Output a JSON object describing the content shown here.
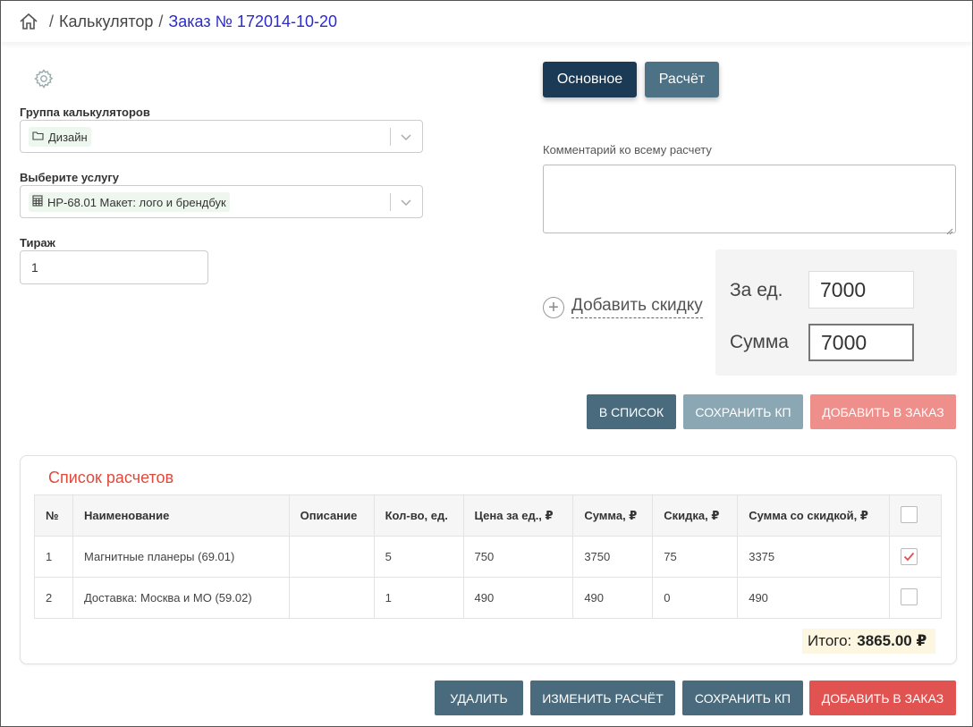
{
  "breadcrumb": {
    "home_icon": "home-icon",
    "sep1": "/",
    "calculator": "Калькулятор",
    "sep2": "/",
    "order": "Заказ № 172014-10-20"
  },
  "form": {
    "group_label": "Группа калькуляторов",
    "group_value": "Дизайн",
    "service_label": "Выберите услугу",
    "service_value": "НР-68.01 Макет: лого и брендбук",
    "qty_label": "Тираж",
    "qty_value": "1"
  },
  "tabs": {
    "main": "Основное",
    "calc": "Расчёт"
  },
  "comment": {
    "label": "Комментарий ко всему расчету",
    "value": ""
  },
  "discount": {
    "label": "Добавить скидку"
  },
  "price": {
    "unit_label": "За ед.",
    "unit_value": "7000",
    "sum_label": "Сумма",
    "sum_value": "7000"
  },
  "actions_top": {
    "to_list": "В СПИСОК",
    "save_kp": "СОХРАНИТЬ КП",
    "add_order": "ДОБАВИТЬ В ЗАКАЗ"
  },
  "list": {
    "title": "Список расчетов",
    "columns": [
      "№",
      "Наименование",
      "Описание",
      "Кол-во, ед.",
      "Цена за ед., ₽",
      "Сумма, ₽",
      "Скидка, ₽",
      "Сумма со скидкой, ₽"
    ],
    "rows": [
      {
        "n": "1",
        "name": "Магнитные планеры (69.01)",
        "desc": "",
        "qty": "5",
        "price": "750",
        "sum": "3750",
        "discount": "75",
        "total": "3375",
        "checked": true
      },
      {
        "n": "2",
        "name": "Доставка: Москва и МО (59.02)",
        "desc": "",
        "qty": "1",
        "price": "490",
        "sum": "490",
        "discount": "0",
        "total": "490",
        "checked": false
      }
    ],
    "total_label": "Итого:",
    "total_value": "3865.00 ₽"
  },
  "actions_bottom": {
    "delete": "УДАЛИТЬ",
    "edit": "ИЗМЕНИТЬ РАСЧЁТ",
    "save_kp": "СОХРАНИТЬ КП",
    "add_order": "ДОБАВИТЬ В ЗАКАЗ"
  },
  "colors": {
    "tab_main": "#1b3a55",
    "tab_calc": "#4d7286",
    "btn_slate": "#4a6b7d",
    "btn_slate_disabled": "#8aa7b3",
    "btn_red": "#e05350",
    "btn_red_disabled": "#ef8f8b",
    "title_red": "#e04a3c"
  }
}
